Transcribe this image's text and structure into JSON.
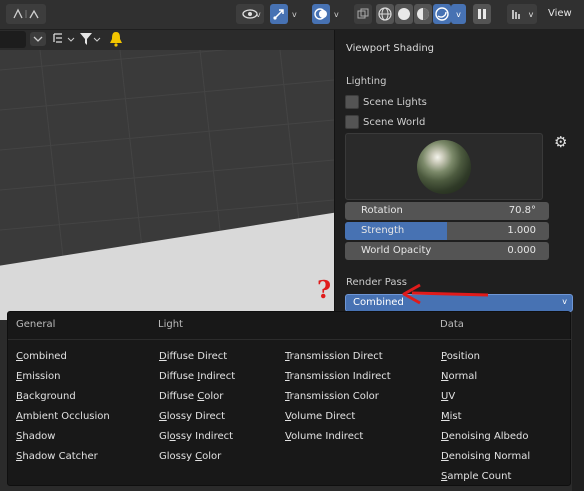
{
  "header": {
    "view_label": "View",
    "chevron": "v",
    "icons": [
      "select-tool-icon",
      "eye-visibility-icon",
      "gizmo-icon",
      "overlay-icon",
      "xray-icon",
      "wireframe-shading-icon",
      "solid-shading-icon",
      "material-shading-icon",
      "rendered-shading-icon",
      "shading-dropdown-icon",
      "pause-icon",
      "editor-type-icon"
    ]
  },
  "subheader": {
    "icons": [
      "collapse-icon",
      "outliner-filter-icon",
      "funnel-filter-icon",
      "bell-warning-icon"
    ]
  },
  "shading_panel": {
    "title": "Viewport Shading",
    "lighting_section": "Lighting",
    "scene_lights_label": "Scene Lights",
    "scene_world_label": "Scene World",
    "rotation": {
      "label": "Rotation",
      "value": "70.8°",
      "fill_fraction": 0.0
    },
    "strength": {
      "label": "Strength",
      "value": "1.000",
      "fill_fraction": 0.5
    },
    "world_opacity": {
      "label": "World Opacity",
      "value": "0.000",
      "fill_fraction": 0.0
    },
    "render_pass_section": "Render Pass",
    "render_pass_selected": "Combined"
  },
  "annotation": {
    "question_mark": "?",
    "arrow_color": "#e01b1b"
  },
  "render_pass_menu": {
    "headers": {
      "general": "General",
      "light": "Light",
      "data": "Data"
    },
    "general_items": [
      {
        "label": "Combined",
        "ul": "C",
        "rest": "ombined"
      },
      {
        "label": "Emission",
        "ul": "E",
        "rest": "mission"
      },
      {
        "label": "Background",
        "ul": "B",
        "rest": "ackground"
      },
      {
        "label": "Ambient Occlusion",
        "ul": "A",
        "rest": "mbient Occlusion"
      },
      {
        "label": "Shadow",
        "ul": "S",
        "rest": "hadow"
      },
      {
        "label": "Shadow Catcher",
        "ul": "S",
        "rest": "hadow Catcher"
      }
    ],
    "light_items": [
      {
        "label": "Diffuse Direct",
        "pre": "",
        "ul": "D",
        "rest": "iffuse Direct"
      },
      {
        "label": "Diffuse Indirect",
        "pre": "Diffuse ",
        "ul": "I",
        "rest": "ndirect"
      },
      {
        "label": "Diffuse Color",
        "pre": "Diffuse ",
        "ul": "C",
        "rest": "olor"
      },
      {
        "label": "Glossy Direct",
        "pre": "",
        "ul": "G",
        "rest": "lossy Direct"
      },
      {
        "label": "Glossy Indirect",
        "pre": "Gl",
        "ul": "o",
        "rest": "ssy Indirect"
      },
      {
        "label": "Glossy Color",
        "pre": "Glossy ",
        "ul": "C",
        "rest": "olor"
      }
    ],
    "transmission_items": [
      {
        "label": "Transmission Direct",
        "ul": "T",
        "rest": "ransmission Direct"
      },
      {
        "label": "Transmission Indirect",
        "ul": "T",
        "rest": "ransmission Indirect"
      },
      {
        "label": "Transmission Color",
        "ul": "T",
        "rest": "ransmission Color"
      },
      {
        "label": "Volume Direct",
        "ul": "V",
        "rest": "olume Direct"
      },
      {
        "label": "Volume Indirect",
        "ul": "V",
        "rest": "olume Indirect"
      }
    ],
    "data_items": [
      {
        "label": "Position",
        "ul": "P",
        "rest": "osition"
      },
      {
        "label": "Normal",
        "ul": "N",
        "rest": "ormal"
      },
      {
        "label": "UV",
        "ul": "U",
        "rest": "V"
      },
      {
        "label": "Mist",
        "ul": "M",
        "rest": "ist"
      },
      {
        "label": "Denoising Albedo",
        "ul": "D",
        "rest": "enoising Albedo"
      },
      {
        "label": "Denoising Normal",
        "ul": "D",
        "rest": "enoising Normal"
      },
      {
        "label": "Sample Count",
        "ul": "S",
        "rest": "ample Count"
      }
    ]
  },
  "colors": {
    "accent": "#4772b3",
    "panel_bg": "#1f1f1f",
    "menu_bg": "#181818",
    "annotation": "#e01b1b"
  }
}
